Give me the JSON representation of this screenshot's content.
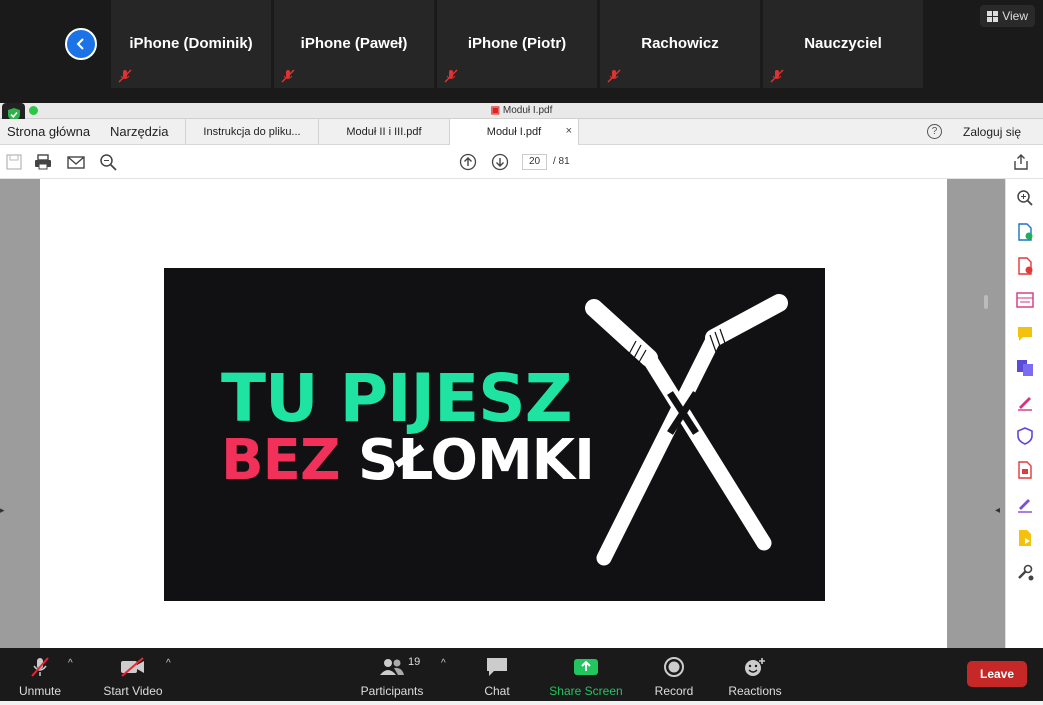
{
  "zoom": {
    "view_label": "View",
    "participants_strip": [
      {
        "name": "iPhone (Dominik)"
      },
      {
        "name": "iPhone (Paweł)"
      },
      {
        "name": "iPhone (Piotr)"
      },
      {
        "name": "Rachowicz"
      },
      {
        "name": "Nauczyciel"
      }
    ],
    "controls": {
      "unmute": "Unmute",
      "start_video": "Start Video",
      "participants": "Participants",
      "participants_count": "19",
      "chat": "Chat",
      "share_screen": "Share Screen",
      "record": "Record",
      "reactions": "Reactions",
      "leave": "Leave"
    },
    "colors": {
      "accent_blue": "#1c73e8",
      "share_green": "#22c55e",
      "leave_red": "#c62828"
    }
  },
  "pdf": {
    "window_title": "Moduł I.pdf",
    "nav": {
      "home": "Strona główna",
      "tools": "Narzędzia"
    },
    "tabs": [
      {
        "label": "Instrukcja do pliku..."
      },
      {
        "label": "Moduł II i III.pdf"
      },
      {
        "label": "Moduł I.pdf",
        "active": true,
        "close": "×"
      }
    ],
    "help": "?",
    "login": "Zaloguj się",
    "page_current": "20",
    "page_total": "/ 81",
    "banner": {
      "line1": "TU PIJESZ",
      "line2_part1": "BEZ",
      "line2_part2": "SŁOMKI",
      "colors": {
        "green": "#1fe3a0",
        "pink": "#f2315b",
        "white": "#ffffff",
        "bg": "#111012"
      }
    }
  }
}
